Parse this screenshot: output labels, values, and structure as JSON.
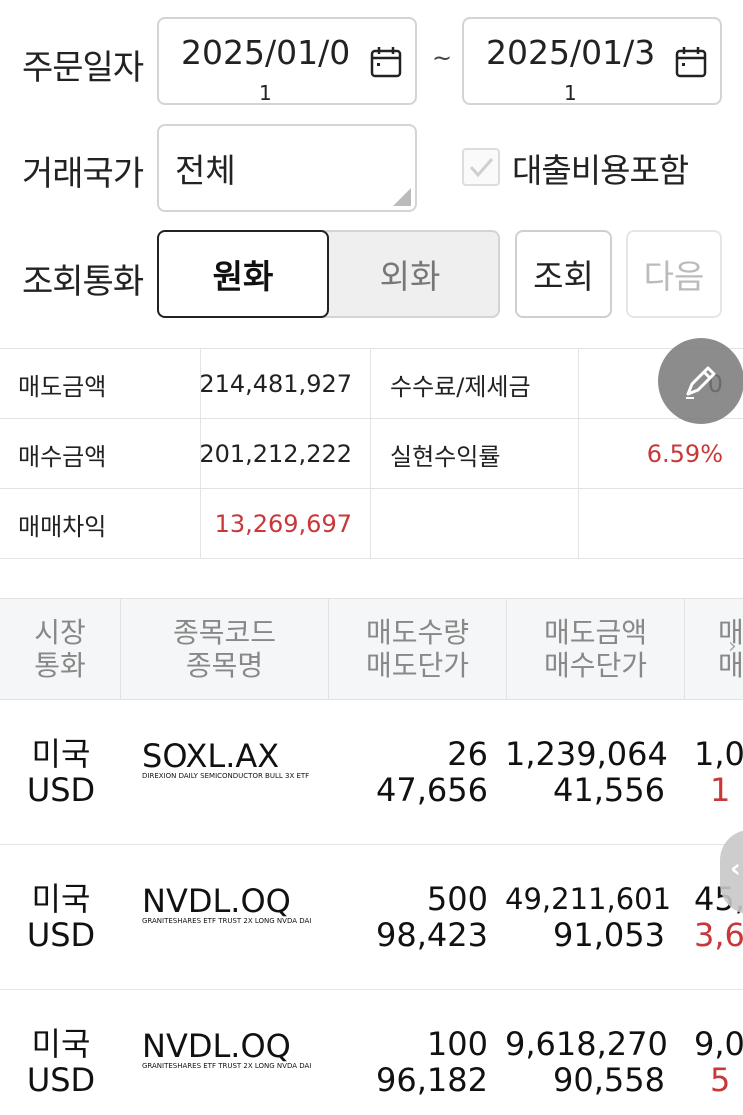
{
  "filters": {
    "order_date_label": "주문일자",
    "start_date": "2025/01/0",
    "start_date_wrap": "1",
    "end_date": "2025/01/3",
    "end_date_wrap": "1",
    "tilde": "~",
    "country_label": "거래국가",
    "country_value": "전체",
    "loan_cost_label": "대출비용포함",
    "loan_cost_checked": true,
    "currency_label": "조회통화",
    "currency_krw": "원화",
    "currency_fx": "외화",
    "query_button": "조회",
    "next_button": "다음"
  },
  "summary": {
    "rows": [
      {
        "label1": "매도금액",
        "value1": "214,481,927",
        "label2": "수수료/제세금",
        "value2": "0"
      },
      {
        "label1": "매수금액",
        "value1": "201,212,222",
        "label2": "실현수익률",
        "value2": "6.59%"
      },
      {
        "label1": "매매차익",
        "value1": "13,269,697",
        "label2": "",
        "value2": ""
      }
    ],
    "positive_color": "#c8383a"
  },
  "table": {
    "headers": [
      {
        "line1": "시장",
        "line2": "통화"
      },
      {
        "line1": "종목코드",
        "line2": "종목명"
      },
      {
        "line1": "매도수량",
        "line2": "매도단가"
      },
      {
        "line1": "매도금액",
        "line2": "매수단가"
      },
      {
        "line1": "매",
        "line2": "매"
      }
    ],
    "rows": [
      {
        "market": "미국",
        "currency": "USD",
        "code": "SOXL.AX",
        "name": "DIREXION DAILY SEMICONDUCTOR BULL 3X ETF",
        "sell_qty": "26",
        "sell_price": "47,656",
        "sell_amount": "1,239,064",
        "buy_price": "41,556",
        "cut_top": "1,0",
        "cut_bottom": "1"
      },
      {
        "market": "미국",
        "currency": "USD",
        "code": "NVDL.OQ",
        "name": "GRANITESHARES ETF TRUST 2X LONG NVDA DAI",
        "sell_qty": "500",
        "sell_price": "98,423",
        "sell_amount": "49,211,601",
        "buy_price": "91,053",
        "cut_top": "45,",
        "cut_bottom": "3,6"
      },
      {
        "market": "미국",
        "currency": "USD",
        "code": "NVDL.OQ",
        "name": "GRANITESHARES ETF TRUST 2X LONG NVDA DAI",
        "sell_qty": "100",
        "sell_price": "96,182",
        "sell_amount": "9,618,270",
        "buy_price": "90,558",
        "cut_top": "9,0",
        "cut_bottom": "5"
      }
    ]
  },
  "icons": {
    "calendar": "calendar-icon",
    "edit": "pencil-icon",
    "check": "check-icon",
    "scroll": "chevron-left-icon"
  }
}
